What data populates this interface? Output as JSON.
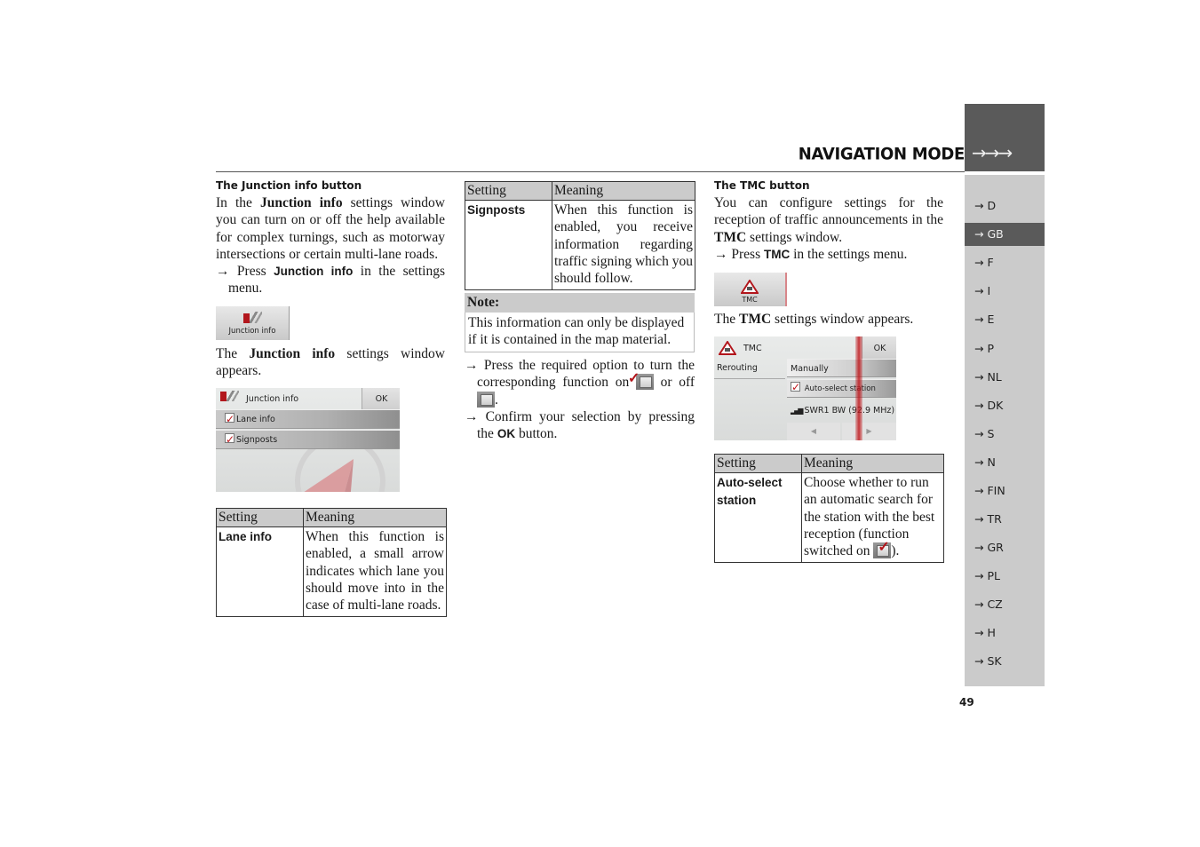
{
  "header": {
    "title": "NAVIGATION MODE",
    "tab_arrows": "→→→"
  },
  "sidebar": {
    "items": [
      {
        "label": "→ D",
        "active": false
      },
      {
        "label": "→ GB",
        "active": true
      },
      {
        "label": "→ F",
        "active": false
      },
      {
        "label": "→ I",
        "active": false
      },
      {
        "label": "→ E",
        "active": false
      },
      {
        "label": "→ P",
        "active": false
      },
      {
        "label": "→ NL",
        "active": false
      },
      {
        "label": "→ DK",
        "active": false
      },
      {
        "label": "→ S",
        "active": false
      },
      {
        "label": "→ N",
        "active": false
      },
      {
        "label": "→ FIN",
        "active": false
      },
      {
        "label": "→ TR",
        "active": false
      },
      {
        "label": "→ GR",
        "active": false
      },
      {
        "label": "→ PL",
        "active": false
      },
      {
        "label": "→ CZ",
        "active": false
      },
      {
        "label": "→ H",
        "active": false
      },
      {
        "label": "→ SK",
        "active": false
      }
    ]
  },
  "page_number": "49",
  "col1": {
    "heading": "The Junction info button",
    "intro_pre": "In the ",
    "intro_bold": "Junction info",
    "intro_post": " settings window you can turn on or off the help available for complex turnings, such as motorway intersections or certain multi-lane roads.",
    "step_arrow": "→",
    "step_pre": "Press ",
    "step_bold": "Junction info",
    "step_post": " in the settings menu.",
    "button_label": "Junction info",
    "appears_pre": "The ",
    "appears_bold": "Junction info",
    "appears_post": " settings window appears.",
    "window": {
      "title": "Junction info",
      "ok": "OK",
      "options": [
        "Lane info",
        "Signposts"
      ]
    },
    "table": {
      "headers": [
        "Setting",
        "Meaning"
      ],
      "rows": [
        {
          "setting": "Lane info",
          "meaning": "When this function is enabled, a small arrow indicates which lane you should move into in the case of multi-lane roads."
        }
      ]
    }
  },
  "col2": {
    "table": {
      "headers": [
        "Setting",
        "Meaning"
      ],
      "rows": [
        {
          "setting": "Signposts",
          "meaning": "When this function is enabled, you receive information regarding traffic signing which you should follow."
        }
      ]
    },
    "note": {
      "title": "Note:",
      "body": "This information can only be displayed if it is contained in the map material."
    },
    "step1_pre": "Press the required option to turn the corresponding function on ",
    "step1_mid": " or off ",
    "step1_post": ".",
    "step2_pre": "Confirm your selection by pressing the ",
    "step2_bold": "OK",
    "step2_post": " button.",
    "arrow": "→"
  },
  "col3": {
    "heading": "The TMC button",
    "intro_pre": "You can configure settings for the reception of traffic announcements in the ",
    "intro_bold": "TMC",
    "intro_post": " settings window.",
    "step_arrow": "→",
    "step_pre": "Press ",
    "step_bold": "TMC",
    "step_post": " in the settings menu.",
    "button_label": "TMC",
    "appears_pre": "The ",
    "appears_bold": "TMC",
    "appears_post": " settings window appears.",
    "window": {
      "title": "TMC",
      "ok": "OK",
      "rerouting_label": "Rerouting",
      "rerouting_value": "Manually",
      "auto_select": "Auto-select station",
      "station": "SWR1 BW (92.9 MHz)",
      "prev": "◀",
      "next": "▶"
    },
    "table": {
      "headers": [
        "Setting",
        "Meaning"
      ],
      "rows": [
        {
          "setting": "Auto-select station",
          "meaning_pre": "Choose whether to run an automatic search for the station with the best reception (function switched on ",
          "meaning_post": ")."
        }
      ]
    }
  }
}
